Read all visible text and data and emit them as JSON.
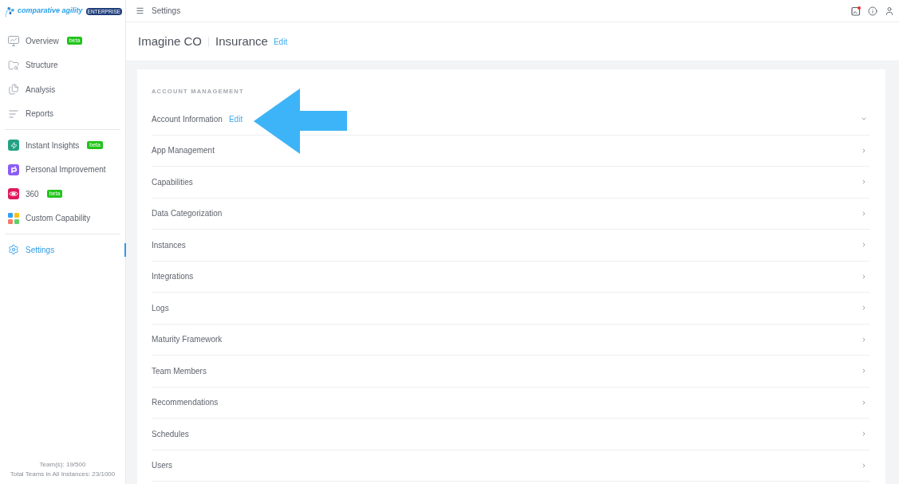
{
  "logo": {
    "name": "comparative agility",
    "badge": "ENTERPRISE"
  },
  "sidebar": {
    "sections": [
      {
        "items": [
          {
            "label": "Overview",
            "badge": "beta",
            "selected": false
          },
          {
            "label": "Structure",
            "selected": false
          },
          {
            "label": "Analysis",
            "selected": false
          },
          {
            "label": "Reports",
            "selected": false
          }
        ]
      },
      {
        "items": [
          {
            "label": "Instant Insights",
            "badge": "beta",
            "selected": false
          },
          {
            "label": "Personal Improvement",
            "selected": false
          },
          {
            "label": "360",
            "badge": "beta",
            "selected": false
          },
          {
            "label": "Custom Capability",
            "selected": false
          }
        ]
      },
      {
        "items": [
          {
            "label": "Settings",
            "selected": true
          }
        ]
      }
    ],
    "footer": [
      "Team(s): 19/500",
      "Total Teams in All Instances: 23/1000"
    ]
  },
  "topbar": {
    "title": "Settings",
    "notification": true
  },
  "header": {
    "organization": "Imagine CO",
    "instance": "Insurance",
    "action": "Edit"
  },
  "panel": {
    "section_title": "ACCOUNT MANAGEMENT",
    "rows": [
      {
        "label": "Account Information",
        "action": "Edit",
        "expanded": true
      },
      {
        "label": "App Management",
        "expanded": false
      },
      {
        "label": "Capabilities",
        "expanded": false
      },
      {
        "label": "Data Categorization",
        "expanded": false
      },
      {
        "label": "Instances",
        "expanded": false
      },
      {
        "label": "Integrations",
        "expanded": false
      },
      {
        "label": "Logs",
        "expanded": false
      },
      {
        "label": "Maturity Framework",
        "expanded": false
      },
      {
        "label": "Team Members",
        "expanded": false
      },
      {
        "label": "Recommendations",
        "expanded": false
      },
      {
        "label": "Schedules",
        "expanded": false
      },
      {
        "label": "Users",
        "expanded": false
      }
    ]
  }
}
